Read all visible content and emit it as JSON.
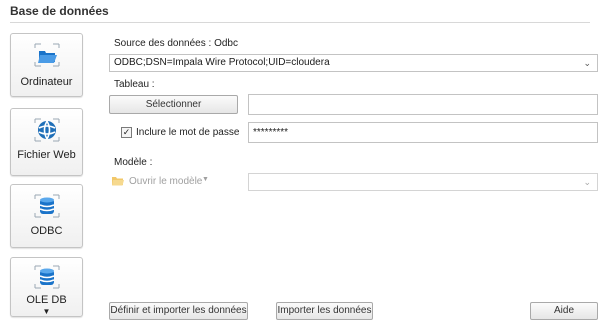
{
  "section_title": "Base de données",
  "sources": [
    {
      "label": "Ordinateur",
      "icon": "folder-icon"
    },
    {
      "label": "Fichier Web",
      "icon": "web-icon"
    },
    {
      "label": "ODBC",
      "icon": "database-icon"
    },
    {
      "label": "OLE DB",
      "icon": "database-icon"
    }
  ],
  "source_label": "Source des données : Odbc",
  "source_value": "ODBC;DSN=Impala Wire Protocol;UID=cloudera",
  "table_label": "Tableau :",
  "select_button": "Sélectionner",
  "table_value": "",
  "password_checkbox": {
    "label": "Inclure le mot de passe",
    "checked": true
  },
  "password_value": "*********",
  "model_label": "Modèle :",
  "open_model": "Ouvrir le modèle",
  "model_value": "",
  "define_import_button": "Définir et importer les données",
  "import_button": "Importer les données",
  "help_button": "Aide",
  "colors": {
    "accent": "#1a73c9",
    "folder": "#f2b544",
    "disabled": "#a0a0a0"
  }
}
